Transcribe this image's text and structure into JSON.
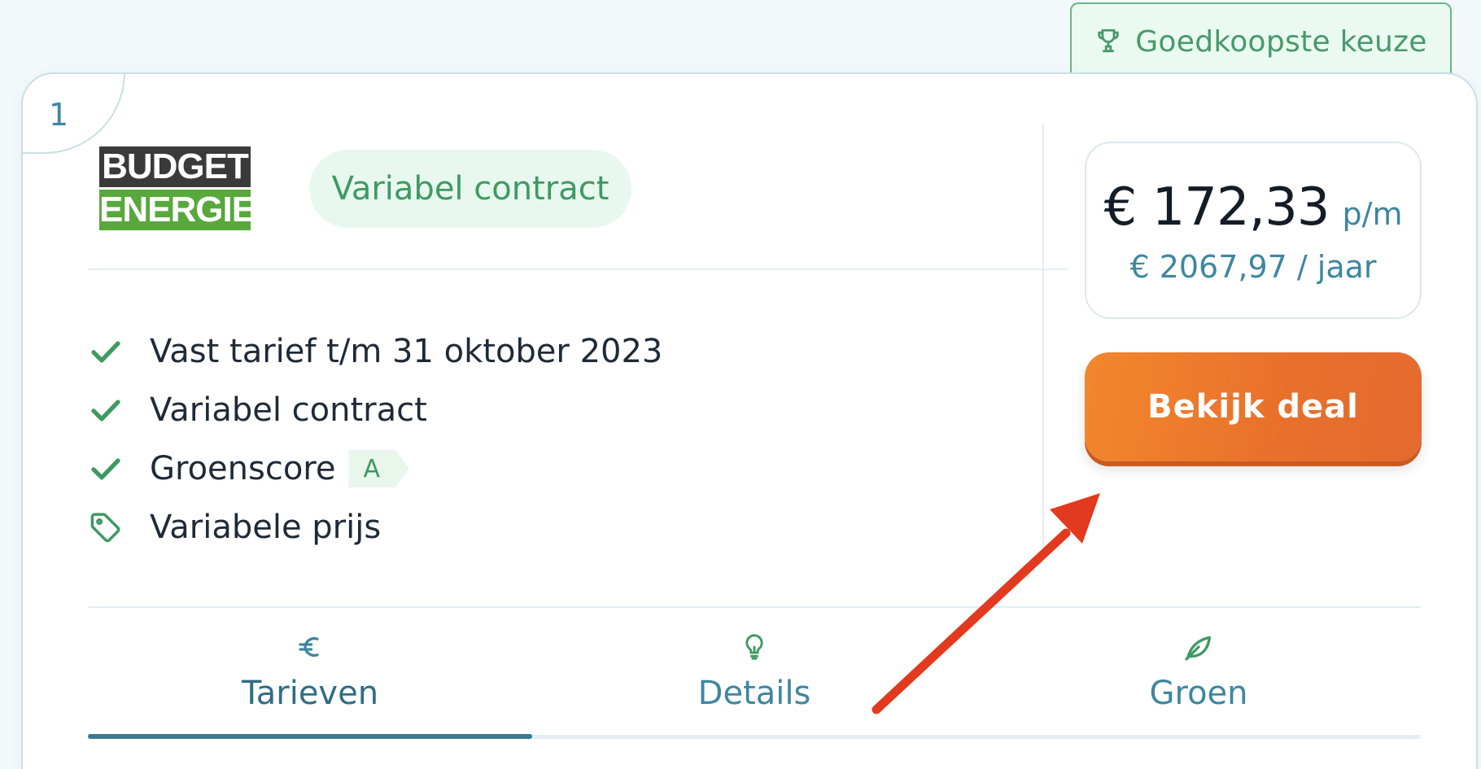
{
  "badge": {
    "label": "Goedkoopste keuze",
    "icon": "trophy-icon"
  },
  "card": {
    "rank": "1",
    "provider_logo": {
      "line1": "BUDGET",
      "line2": "ENERGIE"
    },
    "contract_type": "Variabel contract",
    "features": [
      {
        "icon": "check-icon",
        "label": "Vast tarief t/m 31 oktober 2023"
      },
      {
        "icon": "check-icon",
        "label": "Variabel contract"
      },
      {
        "icon": "check-icon",
        "label": "Groenscore",
        "score": "A"
      },
      {
        "icon": "price-tag-icon",
        "label": "Variabele prijs"
      }
    ],
    "price": {
      "monthly": "€ 172,33",
      "monthly_unit": "p/m",
      "yearly": "€ 2067,97 / jaar"
    },
    "cta_label": "Bekijk deal",
    "tabs": [
      {
        "icon": "euro-icon",
        "label": "Tarieven",
        "active": true
      },
      {
        "icon": "lightbulb-icon",
        "label": "Details",
        "active": false
      },
      {
        "icon": "leaf-icon",
        "label": "Groen",
        "active": false
      }
    ]
  },
  "colors": {
    "accent_green": "#3f9963",
    "accent_teal": "#3e86a0",
    "cta_orange": "#e8702b",
    "annotation_arrow": "#e23a1e"
  }
}
